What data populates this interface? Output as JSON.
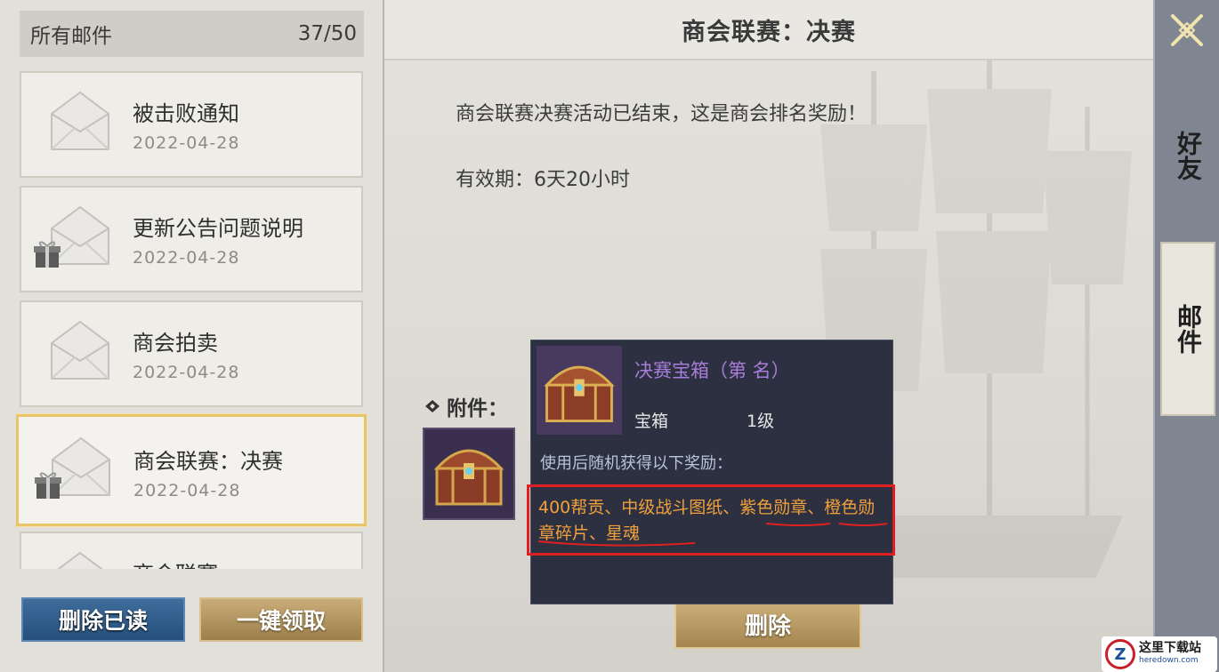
{
  "mail_list": {
    "header_label": "所有邮件",
    "count": "37/50",
    "items": [
      {
        "title": "被击败通知",
        "date": "2022-04-28"
      },
      {
        "title": "更新公告问题说明",
        "date": "2022-04-28"
      },
      {
        "title": "商会拍卖",
        "date": "2022-04-28"
      },
      {
        "title": "商会联赛：决赛",
        "date": "2022-04-28"
      },
      {
        "title": "商会联赛",
        "date": ""
      }
    ],
    "delete_read_label": "删除已读",
    "collect_all_label": "一键领取"
  },
  "mail_detail": {
    "title": "商会联赛：决赛",
    "body": "商会联赛决赛活动已结束，这是商会排名奖励！",
    "validity": "有效期：6天20小时",
    "attachment_label": "附件：",
    "delete_label": "删除"
  },
  "tooltip": {
    "item_name": "决赛宝箱（第   名）",
    "item_type": "宝箱",
    "item_level": "1级",
    "description": "使用后随机获得以下奖励：",
    "rewards": "400帮贡、中级战斗图纸、紫色勋章、橙色勋章碎片、星魂"
  },
  "side_tabs": {
    "friends": "好友",
    "mail": "邮件"
  },
  "watermark": {
    "cn": "这里下载站",
    "en": "heredown.com",
    "logo": "Z"
  },
  "colors": {
    "rewards": "#f0a03c",
    "item_name": "#a77dd9",
    "highlight": "#e02020",
    "selected_border": "#e8c56a"
  }
}
